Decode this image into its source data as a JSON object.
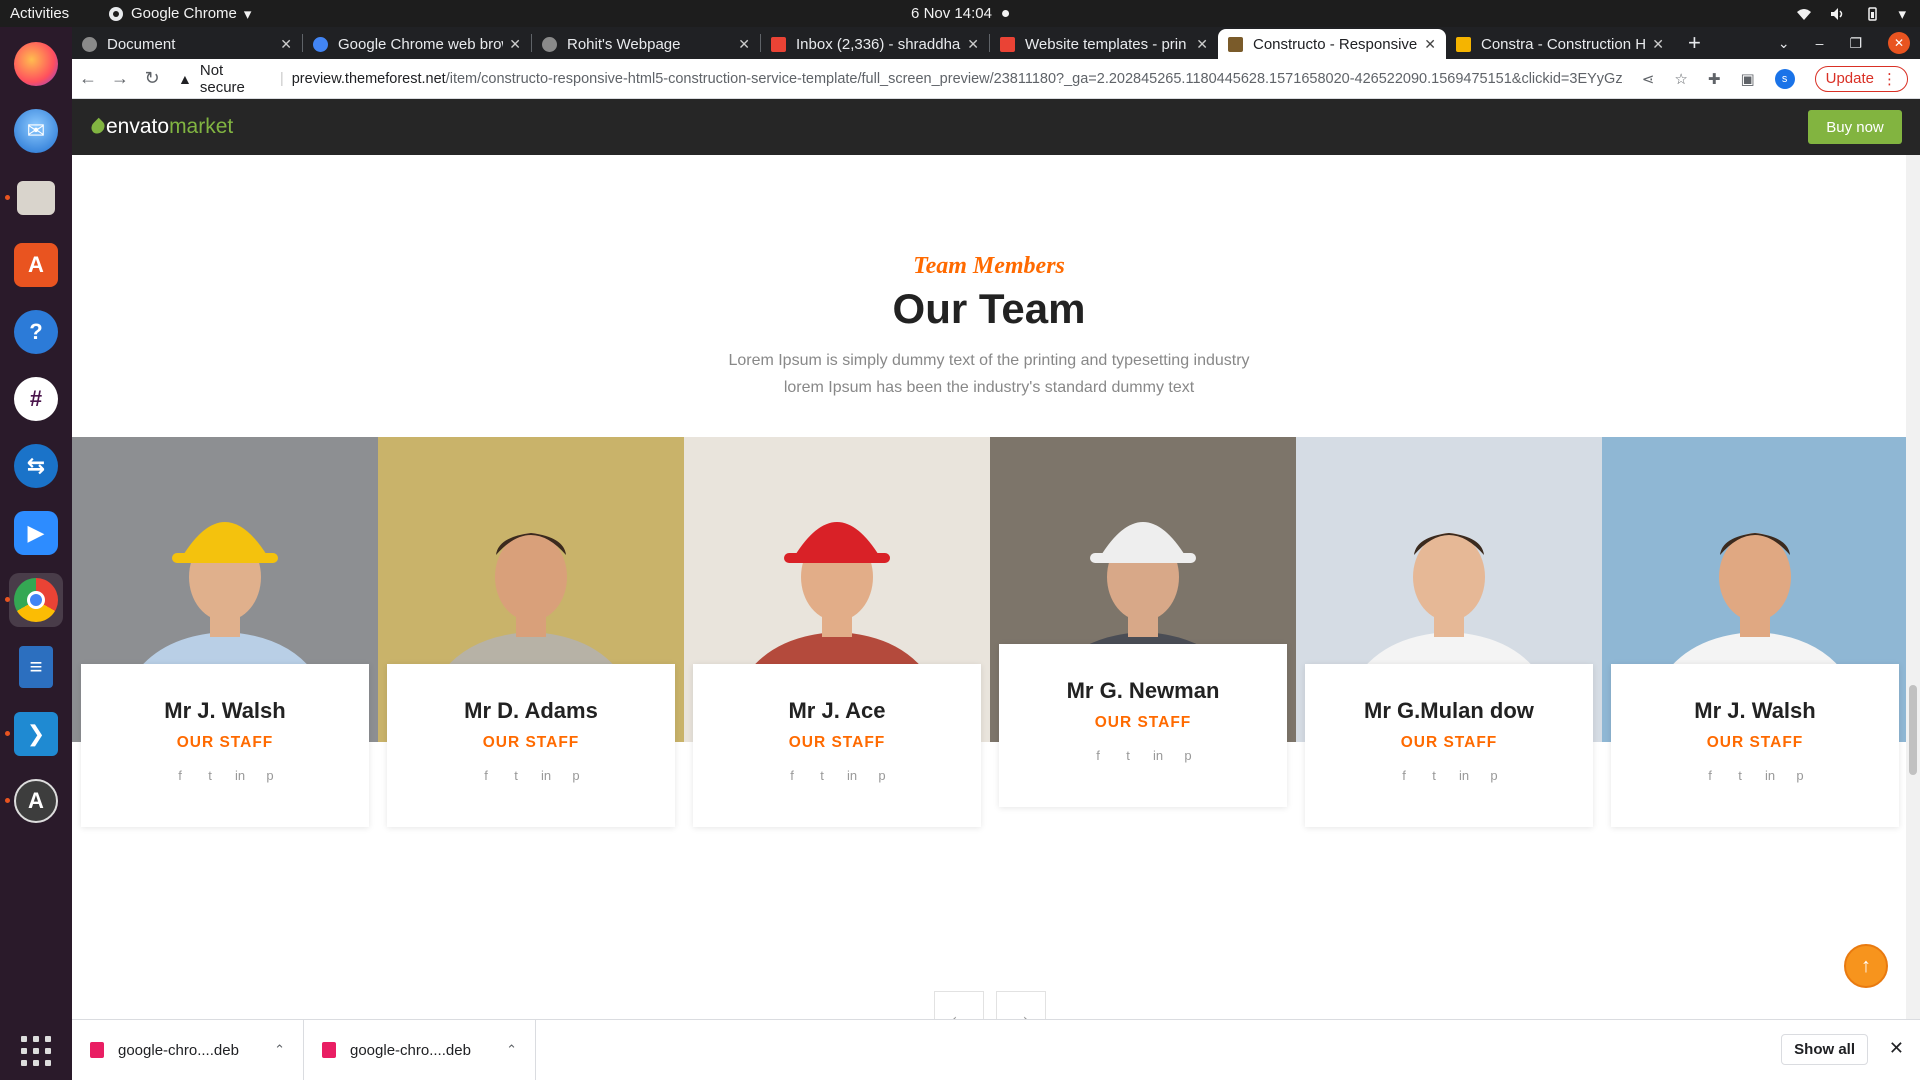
{
  "topbar": {
    "activities": "Activities",
    "app_name": "Google Chrome",
    "clock": "6 Nov  14:04"
  },
  "tabs": [
    {
      "title": "Document",
      "favicon_color": "#8a8a8a",
      "active": false
    },
    {
      "title": "Google Chrome web brows",
      "favicon_color": "#4285f4",
      "active": false
    },
    {
      "title": "Rohit's Webpage",
      "favicon_color": "#8a8a8a",
      "active": false
    },
    {
      "title": "Inbox (2,336) - shraddha",
      "favicon_color": "#ea4335",
      "active": false
    },
    {
      "title": "Website templates - prin",
      "favicon_color": "#ea4335",
      "active": false
    },
    {
      "title": "Constructo - Responsive",
      "favicon_color": "#7a5b2a",
      "active": true
    },
    {
      "title": "Constra - Construction H",
      "favicon_color": "#f5b400",
      "active": false
    }
  ],
  "toolbar": {
    "security": "Not secure",
    "url_host": "preview.themeforest.net",
    "url_path": "/item/constructo-responsive-html5-construction-service-template/full_screen_preview/23811180?_ga=2.202845265.1180445628.1571658020-426522090.1569475151&clickid=3EYyGz...",
    "avatar": "s",
    "update_label": "Update"
  },
  "envato": {
    "brand": "envato",
    "brand_suffix": "market",
    "buy_now": "Buy now"
  },
  "section": {
    "eyebrow": "Team Members",
    "heading": "Our Team",
    "desc_line1": "Lorem Ipsum is simply dummy text of the printing and typesetting industry",
    "desc_line2": "lorem Ipsum has been the industry's standard dummy text"
  },
  "members": [
    {
      "name": "Mr J. Walsh",
      "role": "OUR STAFF",
      "hat": "#f4c20d",
      "shirt": "#b9cfe6",
      "bg": "#8d8f92",
      "skin": "#e0b08c"
    },
    {
      "name": "Mr D. Adams",
      "role": "OUR STAFF",
      "hat": "none",
      "shirt": "#b7b2a6",
      "bg": "#c9b36a",
      "skin": "#d9a07a"
    },
    {
      "name": "Mr J. Ace",
      "role": "OUR STAFF",
      "hat": "#d92127",
      "shirt": "#b44a3c",
      "bg": "#e9e4dc",
      "skin": "#e2ad88"
    },
    {
      "name": "Mr G. Newman",
      "role": "OUR STAFF",
      "hat": "#eeeeee",
      "shirt": "#4a4d55",
      "bg": "#7d756a",
      "skin": "#d8a888"
    },
    {
      "name": "Mr G.Mulan dow",
      "role": "OUR STAFF",
      "hat": "none",
      "shirt": "#f4f4f4",
      "bg": "#d5dce4",
      "skin": "#e6b896"
    },
    {
      "name": "Mr J. Walsh",
      "role": "OUR STAFF",
      "hat": "none",
      "shirt": "#f4f4f4",
      "bg": "#8fb7d4",
      "skin": "#e0a882"
    }
  ],
  "socials": [
    "f",
    "t",
    "in",
    "p"
  ],
  "pager": {
    "prev": "←",
    "next": "→"
  },
  "downloads": [
    {
      "file": "google-chro....deb"
    },
    {
      "file": "google-chro....deb"
    }
  ],
  "shelf": {
    "show_all": "Show all"
  }
}
